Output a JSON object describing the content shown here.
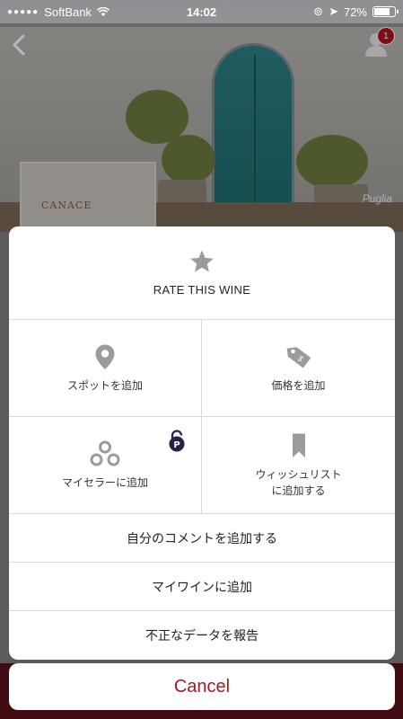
{
  "status_bar": {
    "carrier": "SoftBank",
    "time": "14:02",
    "battery": "72%"
  },
  "header": {
    "notification_count": "1",
    "photo_caption": "Puglia"
  },
  "wine_thumbnail": {
    "label": "CANACE"
  },
  "action_sheet": {
    "rate_label": "RATE THIS WINE",
    "add_spot": "スポットを追加",
    "add_price": "価格を追加",
    "add_to_cellar": "マイセラーに追加",
    "add_to_wishlist_line1": "ウィッシュリスト",
    "add_to_wishlist_line2": "に追加する",
    "add_comment": "自分のコメントを追加する",
    "add_my_wine": "マイワインに追加",
    "report_data": "不正なデータを報告"
  },
  "cancel_label": "Cancel",
  "colors": {
    "accent": "#9b1c2a",
    "icon_gray": "#9b9b9b",
    "badge": "#b01221",
    "premium": "#2b2148"
  },
  "icons": [
    "star-icon",
    "location-pin-icon",
    "price-tag-icon",
    "cellar-icon",
    "bookmark-icon",
    "premium-lock-icon"
  ]
}
